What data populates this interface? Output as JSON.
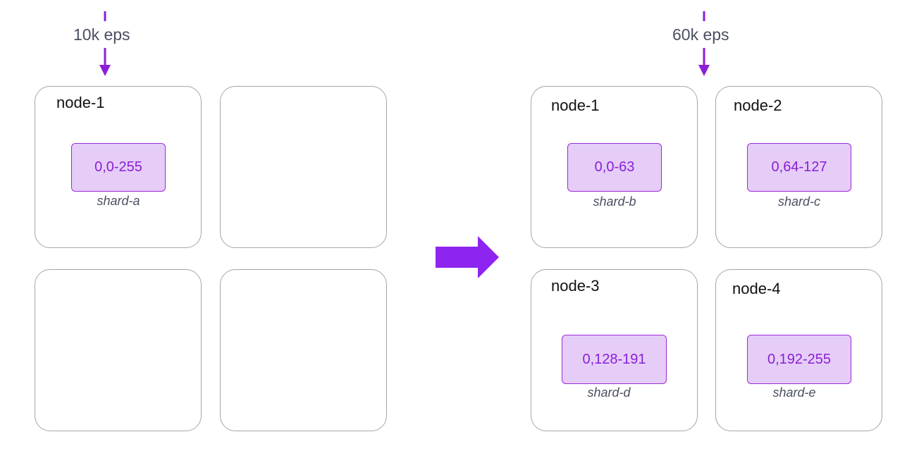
{
  "colors": {
    "accent": "#8a1fd6",
    "shard_fill": "#e5cdf7",
    "node_border": "#a6a6a6",
    "muted_text": "#4a5060"
  },
  "before": {
    "ingest": {
      "label": "10k eps"
    },
    "nodes": [
      {
        "label": "node-1",
        "shard": {
          "range": "0,0-255",
          "name": "shard-a"
        }
      },
      {
        "label": ""
      },
      {
        "label": ""
      },
      {
        "label": ""
      }
    ]
  },
  "after": {
    "ingest": {
      "label": "60k eps"
    },
    "nodes": [
      {
        "label": "node-1",
        "shard": {
          "range": "0,0-63",
          "name": "shard-b"
        }
      },
      {
        "label": "node-2",
        "shard": {
          "range": "0,64-127",
          "name": "shard-c"
        }
      },
      {
        "label": "node-3",
        "shard": {
          "range": "0,128-191",
          "name": "shard-d"
        }
      },
      {
        "label": "node-4",
        "shard": {
          "range": "0,192-255",
          "name": "shard-e"
        }
      }
    ]
  },
  "transition": {
    "icon": "arrow-right-icon"
  }
}
